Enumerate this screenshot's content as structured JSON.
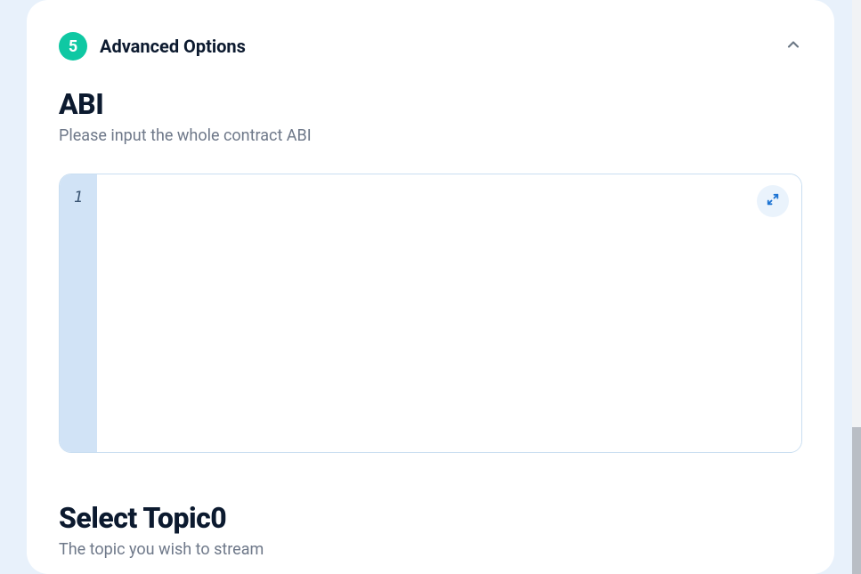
{
  "step": {
    "number": "5",
    "title": "Advanced Options"
  },
  "abi": {
    "heading": "ABI",
    "subtitle": "Please input the whole contract ABI",
    "lineNumber": "1",
    "editorValue": ""
  },
  "topic": {
    "heading": "Select Topic0",
    "subtitle": "The topic you wish to stream"
  }
}
